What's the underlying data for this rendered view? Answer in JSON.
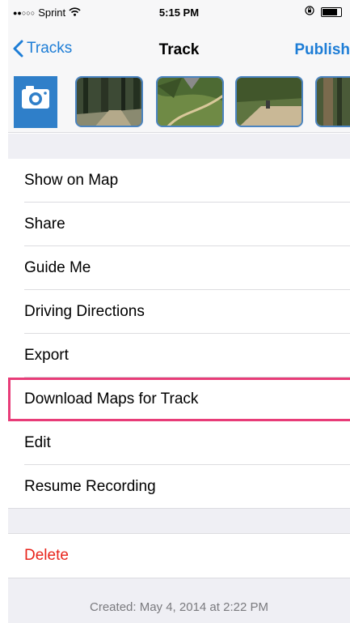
{
  "status_bar": {
    "signal_dots": "●●○○○",
    "carrier": "Sprint",
    "time": "5:15 PM"
  },
  "nav": {
    "back_label": "Tracks",
    "title": "Track",
    "publish_label": "Publish"
  },
  "photos": {
    "count_visible": 4
  },
  "menu": {
    "items": [
      {
        "label": "Show on Map"
      },
      {
        "label": "Share"
      },
      {
        "label": "Guide Me"
      },
      {
        "label": "Driving Directions"
      },
      {
        "label": "Export"
      },
      {
        "label": "Download Maps for Track"
      },
      {
        "label": "Edit"
      },
      {
        "label": "Resume Recording"
      }
    ]
  },
  "delete_label": "Delete",
  "footer": {
    "created_text": "Created: May 4, 2014 at 2:22 PM"
  },
  "colors": {
    "accent": "#1d7dd6",
    "destructive": "#e8241b",
    "highlight_border": "#e83c78",
    "camera_bg": "#2f7fc9"
  },
  "icons": {
    "back": "chevron-left-icon",
    "camera": "camera-icon",
    "wifi": "wifi-icon",
    "orientation_lock": "orientation-lock-icon",
    "battery": "battery-icon",
    "map_pin": "map-pin-icon"
  }
}
